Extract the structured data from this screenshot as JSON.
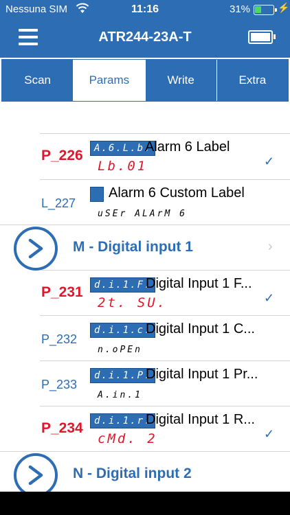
{
  "status": {
    "carrier": "Nessuna SIM",
    "time": "11:16",
    "battery": "31%",
    "battery_fraction": 0.31,
    "battery_color": "#4cd964"
  },
  "nav": {
    "title": "ATR244-23A-T"
  },
  "tabs": [
    {
      "label": "Scan"
    },
    {
      "label": "Params"
    },
    {
      "label": "Write"
    },
    {
      "label": "Extra"
    }
  ],
  "rows": [
    {
      "code": "P_226",
      "lcd": "A.6.L.b.",
      "label": "Alarm 6 Label",
      "value": "Lb.01",
      "checked": true
    },
    {
      "code": "L_227",
      "lcd": "",
      "label": "Alarm 6 Custom Label",
      "value": "uSEr ALArM 6",
      "checked": false
    },
    {
      "code": "P_231",
      "lcd": "d.i.1.F.",
      "label": "Digital Input 1 F...",
      "value": "2t. SU.",
      "checked": true
    },
    {
      "code": "P_232",
      "lcd": "d.i.1.c.",
      "label": "Digital Input 1 C...",
      "value": "n.oPEn",
      "checked": false
    },
    {
      "code": "P_233",
      "lcd": "d.i.1.P.",
      "label": "Digital Input 1 Pr...",
      "value": "A.in.1",
      "checked": false
    },
    {
      "code": "P_234",
      "lcd": "d.i.1.r.",
      "label": "Digital Input 1 R...",
      "value": "cMd. 2",
      "checked": true
    }
  ],
  "groups": [
    {
      "title": "M - Digital input 1"
    },
    {
      "title": "N - Digital input 2"
    }
  ],
  "colors": {
    "brand": "#2c6db4",
    "alert": "#e2162a"
  }
}
